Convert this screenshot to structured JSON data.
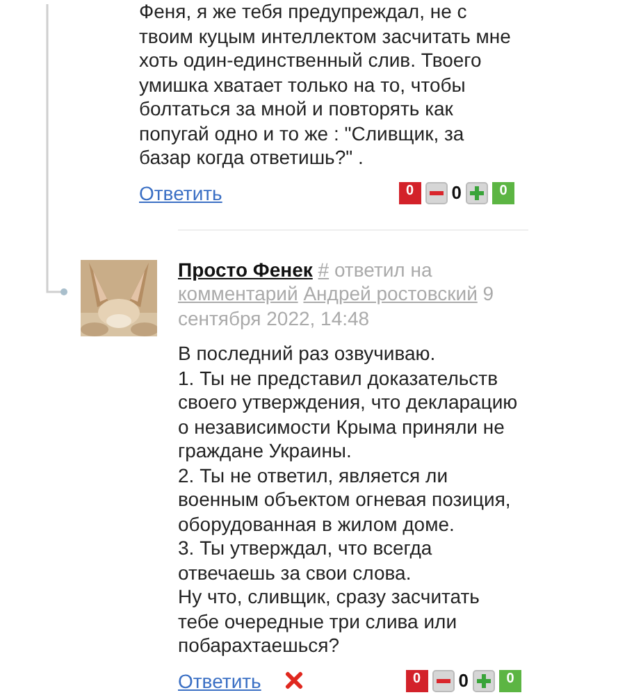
{
  "comments": [
    {
      "is_reply": false,
      "body": "Феня, я же тебя предупреждал, не с твоим куцым интеллектом засчитать мне хоть один-единственный слив. Твоего умишка хватает только на то, чтобы болтаться за мной и повторять как попугай одно и то же : \"Сливщик, за базар когда ответишь?\" .",
      "reply": "Ответить",
      "deletable": false,
      "votes": {
        "minus_count": "0",
        "score": "0",
        "plus_count": "0"
      }
    },
    {
      "is_reply": true,
      "author": "Просто Фенек",
      "anchor": "#",
      "replied": "ответил на",
      "target_label": "комментарий",
      "target_author": "Андрей ростовский",
      "date": "9 сентября 2022, 14:48",
      "body": "В последний раз озвучиваю.\n1. Ты не представил доказательств своего утверждения, что декларацию о независимости Крыма приняли не граждане Украины.\n2. Ты не ответил, является ли военным объектом огневая позиция, оборудованная в жилом доме.\n3. Ты утверждал, что всегда отвечаешь за свои слова.\nНу что, сливщик, сразу засчитать тебе очередные три слива или побарахтаешься?",
      "reply": "Ответить",
      "deletable": true,
      "votes": {
        "minus_count": "0",
        "score": "0",
        "plus_count": "0"
      }
    }
  ]
}
